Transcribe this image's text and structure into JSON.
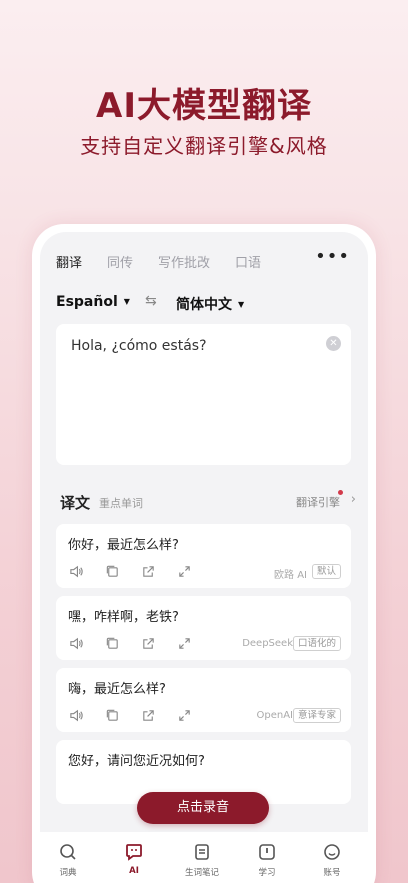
{
  "hero": {
    "title": "AI大模型翻译",
    "subtitle": "支持自定义翻译引擎&风格"
  },
  "tabs": [
    {
      "label": "翻译",
      "active": true
    },
    {
      "label": "同传",
      "active": false
    },
    {
      "label": "写作批改",
      "active": false
    },
    {
      "label": "口语",
      "active": false
    }
  ],
  "more_icon": "more-dots-icon",
  "language": {
    "source": "Español",
    "target": "简体中文",
    "swap_icon": "swap-arrows-icon"
  },
  "input": {
    "text": "Hola, ¿cómo estás?",
    "clear_icon": "clear-circle-icon"
  },
  "result_header": {
    "title": "译文",
    "subtitle": "重点单词",
    "engine_label": "翻译引擎"
  },
  "results": [
    {
      "text": "你好，最近怎么样?",
      "engine": "欧路 AI",
      "style": "默认"
    },
    {
      "text": "嘿，咋样啊，老铁?",
      "engine": "DeepSeek",
      "style": "口语化的"
    },
    {
      "text": "嗨，最近怎么样?",
      "engine": "OpenAI",
      "style": "意译专家"
    },
    {
      "text": "您好，请问您近况如何?",
      "engine": "",
      "style": ""
    }
  ],
  "record_button": "点击录音",
  "bottom_nav": [
    {
      "label": "词典",
      "icon": "search-icon",
      "active": false
    },
    {
      "label": "AI",
      "icon": "ai-chat-icon",
      "active": true
    },
    {
      "label": "生词笔记",
      "icon": "notebook-icon",
      "active": false
    },
    {
      "label": "学习",
      "icon": "study-icon",
      "active": false
    },
    {
      "label": "账号",
      "icon": "smiley-account-icon",
      "active": false
    }
  ],
  "colors": {
    "brand": "#8c1a2b",
    "background": "#f3f3f5"
  }
}
